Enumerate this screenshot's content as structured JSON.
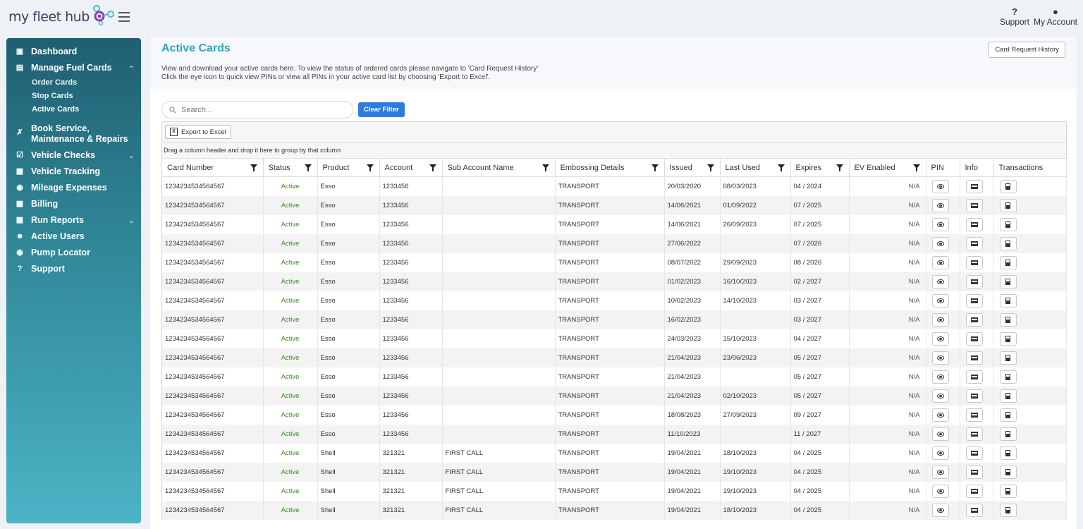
{
  "app": {
    "logo_text": "my fleet hub",
    "support_label": "Support",
    "account_label": "My Account"
  },
  "sidebar": {
    "items": [
      {
        "label": "Dashboard",
        "icon": "dashboard-icon"
      },
      {
        "label": "Manage Fuel Cards",
        "icon": "card-icon",
        "expanded": true,
        "children": [
          "Order Cards",
          "Stop Cards",
          "Active Cards"
        ],
        "active_child": "Active Cards"
      },
      {
        "label": "Book Service, Maintenance & Repairs",
        "icon": "tools-icon"
      },
      {
        "label": "Vehicle Checks",
        "icon": "checklist-icon"
      },
      {
        "label": "Vehicle Tracking",
        "icon": "truck-icon"
      },
      {
        "label": "Mileage Expenses",
        "icon": "car-icon"
      },
      {
        "label": "Billing",
        "icon": "invoice-icon"
      },
      {
        "label": "Run Reports",
        "icon": "report-icon"
      },
      {
        "label": "Active Users",
        "icon": "users-icon"
      },
      {
        "label": "Pump Locator",
        "icon": "location-pin-icon"
      },
      {
        "label": "Support",
        "icon": "question-icon"
      }
    ]
  },
  "page": {
    "title": "Active Cards",
    "card_request_history_label": "Card Request History",
    "description_line1": "View and download your active cards here. To view the status of ordered cards please navigate to 'Card Request History'",
    "description_line2": "Click the eye icon to quick view PINs or view all PINs in your active card list by choosing 'Export to Excel'.",
    "search_placeholder": "Search...",
    "clear_filter_label": "Clear Filter",
    "export_label": "Export to Excel",
    "group_hint": "Drag a column header and drop it here to group by that column"
  },
  "table": {
    "columns": [
      "Card Number",
      "Status",
      "Product",
      "Account",
      "Sub Account Name",
      "Embossing Details",
      "Issued",
      "Last Used",
      "Expires",
      "EV Enabled",
      "PIN",
      "Info",
      "Transactions"
    ],
    "rows": [
      [
        "1234234534564567",
        "Active",
        "Esso",
        "1233456",
        "",
        "TRANSPORT",
        "20/03/2020",
        "08/03/2023",
        "04 / 2024",
        "N/A"
      ],
      [
        "1234234534564567",
        "Active",
        "Esso",
        "1233456",
        "",
        "TRANSPORT",
        "14/06/2021",
        "01/09/2022",
        "07 / 2025",
        "N/A"
      ],
      [
        "1234234534564567",
        "Active",
        "Esso",
        "1233456",
        "",
        "TRANSPORT",
        "14/06/2021",
        "26/09/2023",
        "07 / 2025",
        "N/A"
      ],
      [
        "1234234534564567",
        "Active",
        "Esso",
        "1233456",
        "",
        "TRANSPORT",
        "27/06/2022",
        "",
        "07 / 2026",
        "N/A"
      ],
      [
        "1234234534564567",
        "Active",
        "Esso",
        "1233456",
        "",
        "TRANSPORT",
        "08/07/2022",
        "29/09/2023",
        "08 / 2026",
        "N/A"
      ],
      [
        "1234234534564567",
        "Active",
        "Esso",
        "1233456",
        "",
        "TRANSPORT",
        "01/02/2023",
        "16/10/2023",
        "02 / 2027",
        "N/A"
      ],
      [
        "1234234534564567",
        "Active",
        "Esso",
        "1233456",
        "",
        "TRANSPORT",
        "10/02/2023",
        "14/10/2023",
        "03 / 2027",
        "N/A"
      ],
      [
        "1234234534564567",
        "Active",
        "Esso",
        "1233456",
        "",
        "TRANSPORT",
        "16/02/2023",
        "",
        "03 / 2027",
        "N/A"
      ],
      [
        "1234234534564567",
        "Active",
        "Esso",
        "1233456",
        "",
        "TRANSPORT",
        "24/03/2023",
        "15/10/2023",
        "04 / 2027",
        "N/A"
      ],
      [
        "1234234534564567",
        "Active",
        "Esso",
        "1233456",
        "",
        "TRANSPORT",
        "21/04/2023",
        "23/06/2023",
        "05 / 2027",
        "N/A"
      ],
      [
        "1234234534564567",
        "Active",
        "Esso",
        "1233456",
        "",
        "TRANSPORT",
        "21/04/2023",
        "",
        "05 / 2027",
        "N/A"
      ],
      [
        "1234234534564567",
        "Active",
        "Esso",
        "1233456",
        "",
        "TRANSPORT",
        "21/04/2023",
        "02/10/2023",
        "05 / 2027",
        "N/A"
      ],
      [
        "1234234534564567",
        "Active",
        "Esso",
        "1233456",
        "",
        "TRANSPORT",
        "18/08/2023",
        "27/09/2023",
        "09 / 2027",
        "N/A"
      ],
      [
        "1234234534564567",
        "Active",
        "Esso",
        "1233456",
        "",
        "TRANSPORT",
        "11/10/2023",
        "",
        "11 / 2027",
        "N/A"
      ],
      [
        "1234234534564567",
        "Active",
        "Shell",
        "321321",
        "FIRST CALL",
        "TRANSPORT",
        "19/04/2021",
        "18/10/2023",
        "04 / 2025",
        "N/A"
      ],
      [
        "1234234534564567",
        "Active",
        "Shell",
        "321321",
        "FIRST CALL",
        "TRANSPORT",
        "19/04/2021",
        "19/10/2023",
        "04 / 2025",
        "N/A"
      ],
      [
        "1234234534564567",
        "Active",
        "Shell",
        "321321",
        "FIRST CALL",
        "TRANSPORT",
        "19/04/2021",
        "19/10/2023",
        "04 / 2025",
        "N/A"
      ],
      [
        "1234234534564567",
        "Active",
        "Shell",
        "321321",
        "FIRST CALL",
        "TRANSPORT",
        "19/04/2021",
        "18/10/2023",
        "04 / 2025",
        "N/A"
      ]
    ]
  },
  "colors": {
    "accent": "#2aa7bd",
    "button_blue": "#2f7be0",
    "status_green": "#3a8a2a"
  }
}
